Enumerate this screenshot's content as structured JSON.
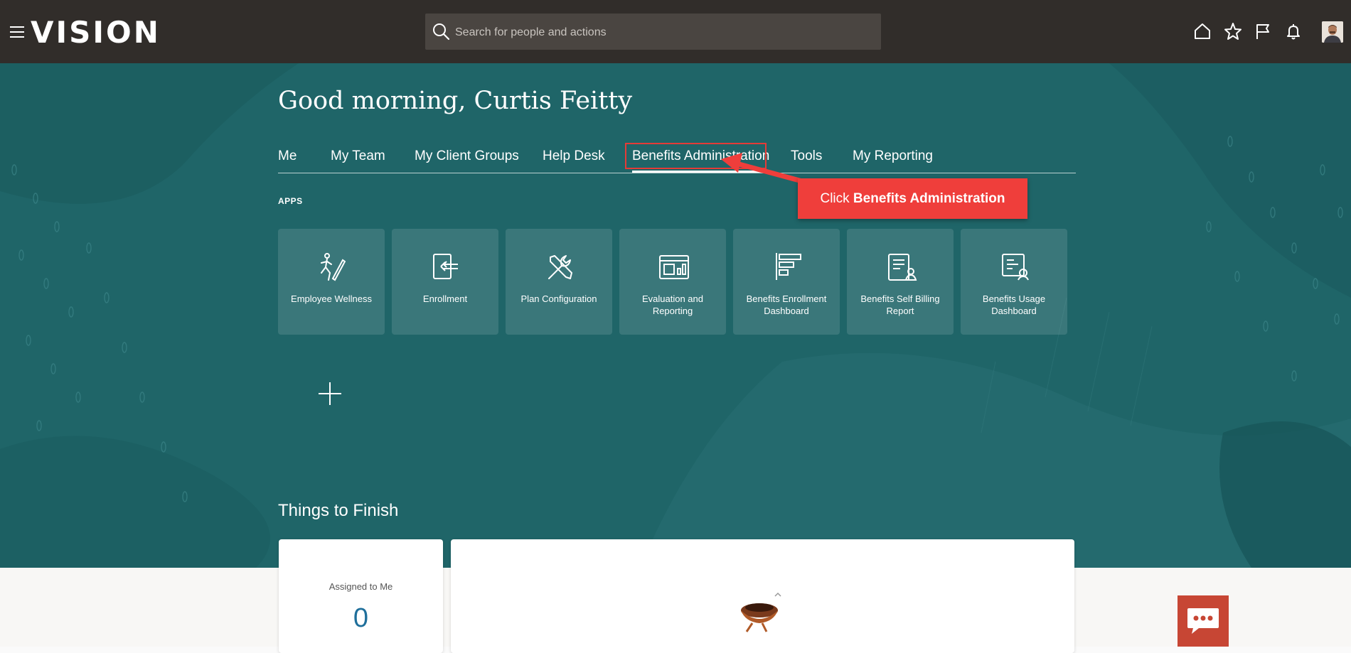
{
  "topbar": {
    "logo": "VISION",
    "search_placeholder": "Search for people and actions",
    "icons": [
      "home-icon",
      "favorites-star-icon",
      "flag-icon",
      "notifications-bell-icon"
    ]
  },
  "greeting": "Good morning, Curtis Feitty",
  "tabs": [
    "Me",
    "My Team",
    "My Client Groups",
    "Help Desk",
    "Benefits Administration",
    "Tools",
    "My Reporting"
  ],
  "active_tab": "Benefits Administration",
  "callout": {
    "prefix": "Click ",
    "bold": "Benefits Administration"
  },
  "apps_label": "APPS",
  "apps": [
    {
      "label": "Employee Wellness",
      "icon": "wellness-icon"
    },
    {
      "label": "Enrollment",
      "icon": "enrollment-icon"
    },
    {
      "label": "Plan Configuration",
      "icon": "tools-icon"
    },
    {
      "label": "Evaluation and Reporting",
      "icon": "report-icon"
    },
    {
      "label": "Benefits Enrollment Dashboard",
      "icon": "dashboard-icon"
    },
    {
      "label": "Benefits Self Billing Report",
      "icon": "billing-report-icon"
    },
    {
      "label": "Benefits Usage Dashboard",
      "icon": "usage-dashboard-icon"
    }
  ],
  "things_to_finish": {
    "title": "Things to Finish",
    "assigned_label": "Assigned to Me",
    "assigned_count": "0"
  },
  "colors": {
    "topbar": "#312d2a",
    "hero": "#1f6568",
    "callout": "#ef3e3b",
    "chat": "#c74634"
  }
}
